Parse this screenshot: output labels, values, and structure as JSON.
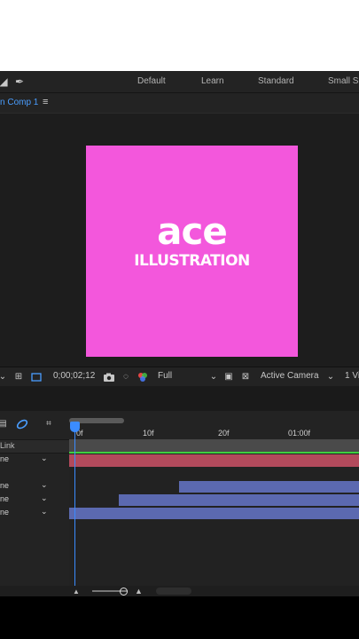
{
  "workspaces": [
    "Default",
    "Learn",
    "Standard",
    "Small Sc"
  ],
  "composition": {
    "tab_prefix": "n",
    "tab_label": "Comp 1",
    "canvas_color": "#f357dc"
  },
  "logo": {
    "line1": "ace",
    "line2": "ILLUSTRATION"
  },
  "viewer_bar": {
    "timecode": "0;00;02;12",
    "resolution": "Full",
    "camera": "Active Camera",
    "views": "1 Vi"
  },
  "timeline": {
    "ruler_labels": [
      "0f",
      "10f",
      "20f",
      "01:00f"
    ],
    "column_header": "Link",
    "layers": [
      {
        "parent": "ne"
      },
      {
        "parent": "ne"
      },
      {
        "parent": "ne"
      },
      {
        "parent": "ne"
      }
    ]
  },
  "colors": {
    "accent": "#3b8cff",
    "layer_red": "#b24a5c",
    "layer_blue": "#5b69b0",
    "green_line": "#3fcf3f"
  }
}
